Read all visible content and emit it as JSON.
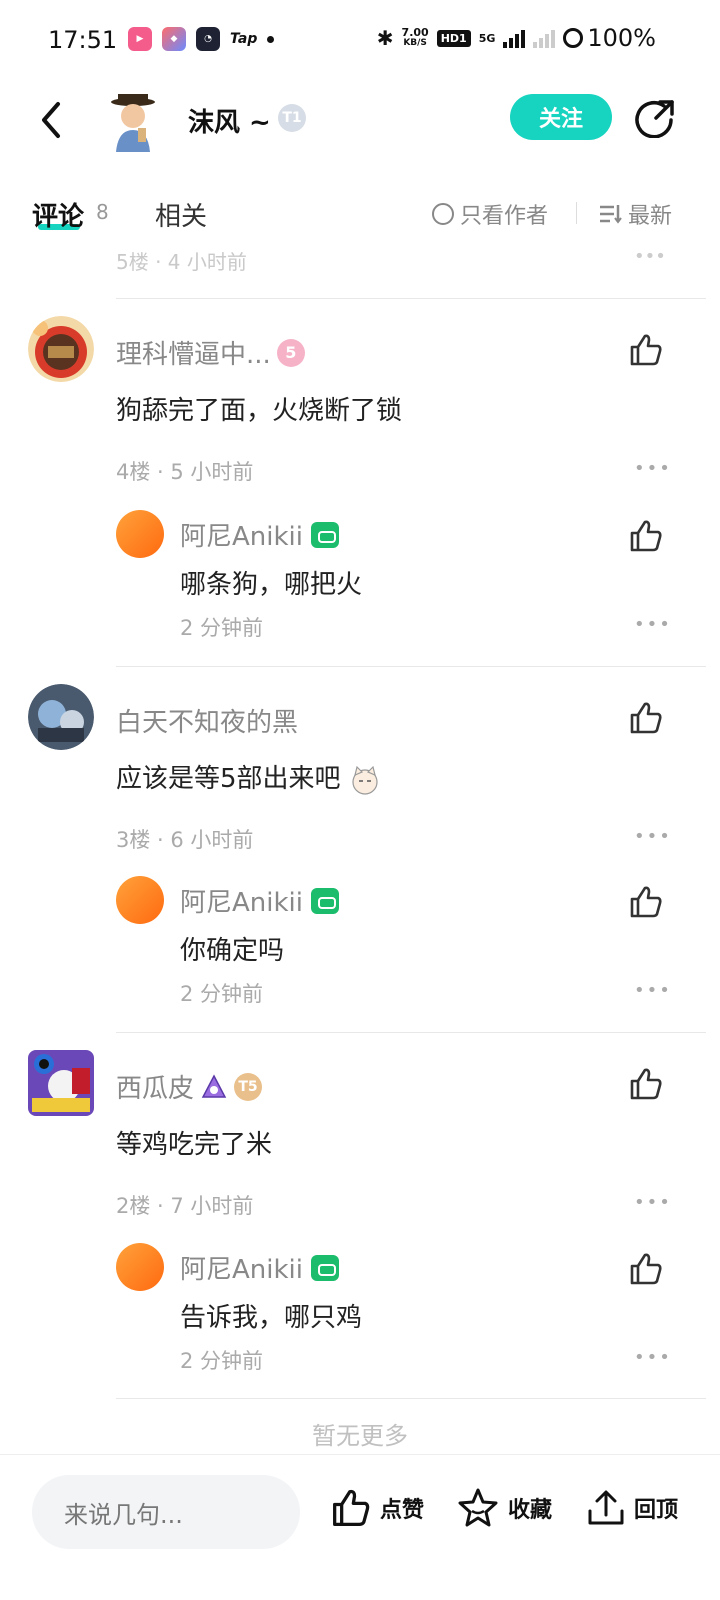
{
  "status_bar": {
    "time": "17:51",
    "apps": [
      "bilibili-icon",
      "app-icon",
      "clock-app-icon",
      "Tap"
    ],
    "net_speed_value": "7.00",
    "net_speed_unit": "KB/S",
    "hd_label": "HD1",
    "network_label": "5G",
    "battery": "100%"
  },
  "header": {
    "author_name": "沫风 ~",
    "author_badge": "T1",
    "follow_label": "关注"
  },
  "tabs": {
    "comments_label": "评论",
    "comments_count": "8",
    "related_label": "相关",
    "only_author_label": "只看作者",
    "sort_label": "最新"
  },
  "partial_row": {
    "text": "5楼 · 4 小时前"
  },
  "comments": [
    {
      "name": "理科懵逼中...",
      "badge": "5",
      "text": "狗舔完了面，火烧断了锁",
      "meta": "4楼 · 5 小时前",
      "reply": {
        "name": "阿尼Anikii",
        "text": "哪条狗，哪把火",
        "time": "2 分钟前"
      }
    },
    {
      "name": "白天不知夜的黑",
      "text": "应该是等5部出来吧",
      "meta": "3楼 · 6 小时前",
      "reply": {
        "name": "阿尼Anikii",
        "text": "你确定吗",
        "time": "2 分钟前"
      }
    },
    {
      "name": "西瓜皮",
      "badge": "T5",
      "text": "等鸡吃完了米",
      "meta": "2楼 · 7 小时前",
      "reply": {
        "name": "阿尼Anikii",
        "text": "告诉我，哪只鸡",
        "time": "2 分钟前"
      }
    }
  ],
  "no_more": "暂无更多",
  "bottom_bar": {
    "input_placeholder": "来说几句...",
    "like_label": "点赞",
    "favorite_label": "收藏",
    "top_label": "回顶"
  },
  "colors": {
    "accent": "#16d4c0",
    "reply_avatar": "#ff8a1e",
    "verified_badge": "#1bbd6c"
  }
}
